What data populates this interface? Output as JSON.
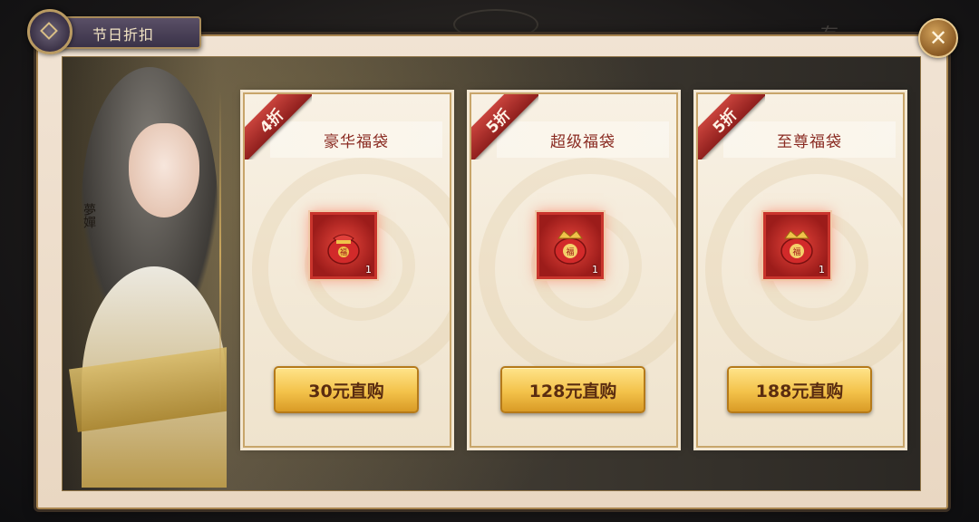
{
  "window": {
    "title": "节日折扣",
    "background_text": "有",
    "close_label": "✕"
  },
  "character": {
    "signature": "夢嬋"
  },
  "offers": [
    {
      "discount": "4折",
      "name": "豪华福袋",
      "item_icon": "lucky-bag-icon",
      "item_count": "1",
      "price_button": "30元直购"
    },
    {
      "discount": "5折",
      "name": "超级福袋",
      "item_icon": "gold-lucky-bag-icon",
      "item_count": "1",
      "price_button": "128元直购"
    },
    {
      "discount": "5折",
      "name": "至尊福袋",
      "item_icon": "gold-lucky-bag-icon",
      "item_count": "1",
      "price_button": "188元直购"
    }
  ],
  "colors": {
    "ribbon": "#b8302c",
    "item_bg": "#c92f28",
    "button_gold": "#f3c24a",
    "name_text": "#8a2b22"
  }
}
